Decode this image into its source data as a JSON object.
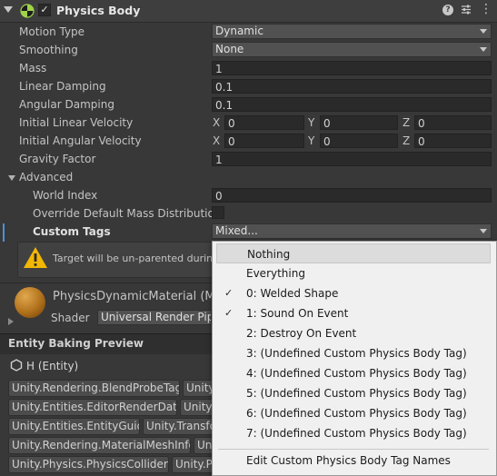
{
  "header": {
    "title": "Physics Body"
  },
  "properties": {
    "motion_type": {
      "label": "Motion Type",
      "value": "Dynamic"
    },
    "smoothing": {
      "label": "Smoothing",
      "value": "None"
    },
    "mass": {
      "label": "Mass",
      "value": "1"
    },
    "linear_damping": {
      "label": "Linear Damping",
      "value": "0.1"
    },
    "angular_damping": {
      "label": "Angular Damping",
      "value": "0.1"
    },
    "initial_linear_velocity": {
      "label": "Initial Linear Velocity",
      "x": "0",
      "y": "0",
      "z": "0"
    },
    "initial_angular_velocity": {
      "label": "Initial Angular Velocity",
      "x": "0",
      "y": "0",
      "z": "0"
    },
    "gravity_factor": {
      "label": "Gravity Factor",
      "value": "1"
    },
    "axis_labels": {
      "x": "X",
      "y": "Y",
      "z": "Z"
    },
    "advanced": {
      "label": "Advanced"
    },
    "world_index": {
      "label": "World Index",
      "value": "0"
    },
    "override_mass": {
      "label": "Override Default Mass Distribution",
      "checked": false
    },
    "custom_tags": {
      "label": "Custom Tags",
      "value": "Mixed..."
    }
  },
  "warning": {
    "text": "Target will be un-parented during the"
  },
  "material": {
    "name": "PhysicsDynamicMaterial (Ma",
    "shader_label": "Shader",
    "shader_value": "Universal Render Pipe"
  },
  "baking": {
    "section_title": "Entity Baking Preview",
    "entity_label": "H (Entity)",
    "tags": [
      [
        "Unity.Rendering.BlendProbeTag",
        "Unity"
      ],
      [
        "Unity.Entities.EditorRenderData",
        "Unity"
      ],
      [
        "Unity.Entities.EntityGuid",
        "Unity.Transfo"
      ],
      [
        "Unity.Rendering.MaterialMeshInfo",
        "Uni"
      ],
      [
        "Unity.Physics.PhysicsCollider",
        "Unity.P"
      ]
    ]
  },
  "menu": {
    "items": [
      {
        "label": "Nothing",
        "checked": false
      },
      {
        "label": "Everything",
        "checked": false
      },
      {
        "label": "0: Welded Shape",
        "checked": true
      },
      {
        "label": "1: Sound On Event",
        "checked": true
      },
      {
        "label": "2: Destroy On Event",
        "checked": false
      },
      {
        "label": "3: (Undefined Custom Physics Body Tag)",
        "checked": false
      },
      {
        "label": "4: (Undefined Custom Physics Body Tag)",
        "checked": false
      },
      {
        "label": "5: (Undefined Custom Physics Body Tag)",
        "checked": false
      },
      {
        "label": "6: (Undefined Custom Physics Body Tag)",
        "checked": false
      },
      {
        "label": "7: (Undefined Custom Physics Body Tag)",
        "checked": false
      }
    ],
    "edit_label": "Edit Custom Physics Body Tag Names",
    "check_glyph": "✓"
  }
}
